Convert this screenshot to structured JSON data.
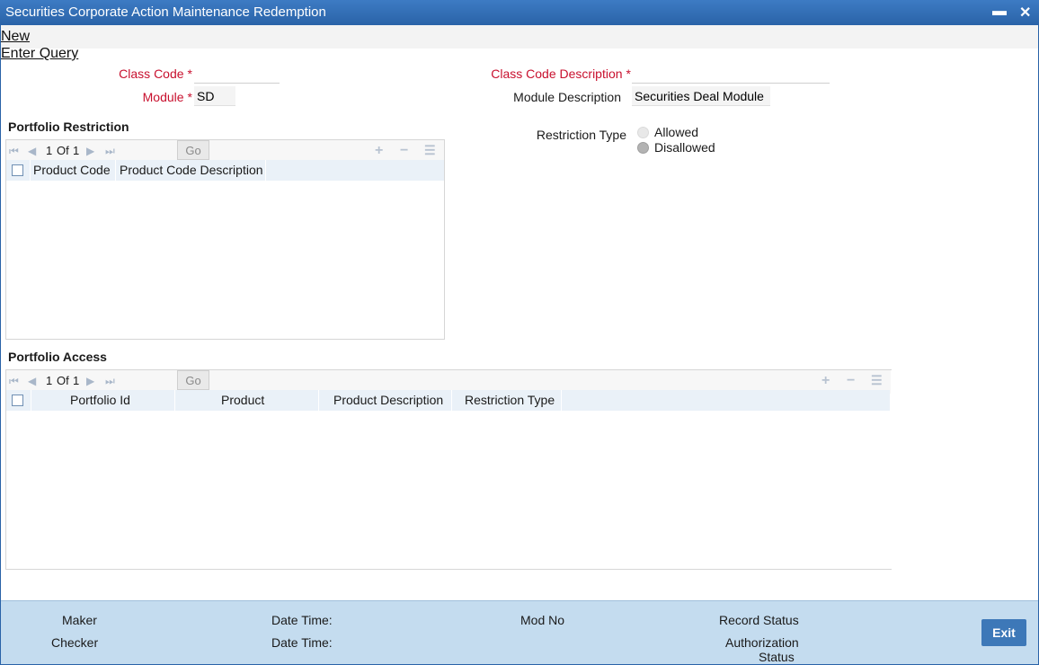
{
  "window": {
    "title": "Securities Corporate Action Maintenance Redemption",
    "minimize": "▬",
    "close": "✕"
  },
  "menu": {
    "new": "New",
    "enter_query": "Enter Query"
  },
  "form": {
    "class_code_label": "Class Code",
    "class_code_value": "",
    "class_code_desc_label": "Class Code Description",
    "class_code_desc_value": "",
    "module_label": "Module",
    "module_value": "SD",
    "module_desc_label": "Module Description",
    "module_desc_value": "Securities Deal Module",
    "required_mark": "*"
  },
  "portfolio_restriction": {
    "title": "Portfolio Restriction",
    "page_current": "1",
    "page_of": "Of",
    "page_total": "1",
    "go": "Go",
    "columns": [
      "Product Code",
      "Product Code Description"
    ]
  },
  "restriction_type": {
    "label": "Restriction Type",
    "options": [
      "Allowed",
      "Disallowed"
    ],
    "selected": "Disallowed"
  },
  "portfolio_access": {
    "title": "Portfolio Access",
    "page_current": "1",
    "page_of": "Of",
    "page_total": "1",
    "go": "Go",
    "columns": [
      "Portfolio Id",
      "Product",
      "Product Description",
      "Restriction Type"
    ]
  },
  "footer": {
    "maker": "Maker",
    "checker": "Checker",
    "date_time_1": "Date Time:",
    "date_time_2": "Date Time:",
    "mod_no": "Mod No",
    "record_status": "Record Status",
    "auth_status_1": "Authorization",
    "auth_status_2": "Status",
    "exit": "Exit"
  }
}
